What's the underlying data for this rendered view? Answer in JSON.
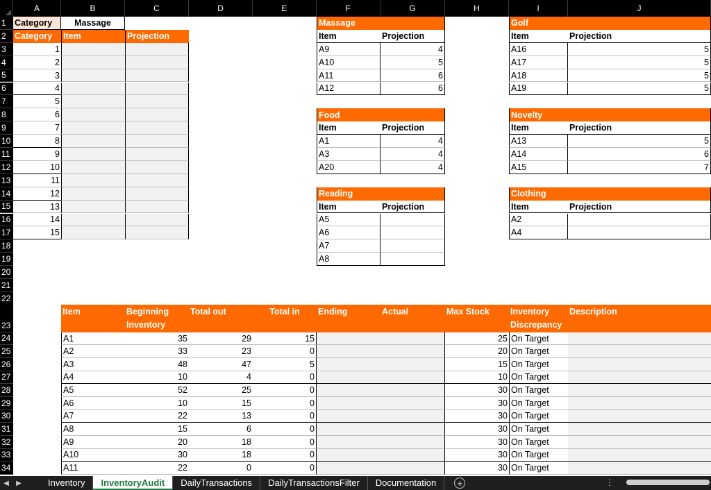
{
  "columns": [
    "A",
    "B",
    "C",
    "D",
    "E",
    "F",
    "G",
    "H",
    "I",
    "J"
  ],
  "rows": [
    "1",
    "2",
    "3",
    "4",
    "5",
    "6",
    "7",
    "8",
    "9",
    "10",
    "11",
    "12",
    "13",
    "14",
    "15",
    "16",
    "17",
    "18",
    "19",
    "20",
    "21",
    "22",
    "23",
    "24",
    "25",
    "26",
    "27",
    "28",
    "29",
    "30",
    "31",
    "32",
    "33",
    "34"
  ],
  "left_panel": {
    "a1": "Category",
    "b1": "Massage",
    "headers": [
      "Category",
      "Item",
      "Projection"
    ],
    "numbers": [
      "1",
      "2",
      "3",
      "4",
      "5",
      "6",
      "7",
      "8",
      "9",
      "10",
      "11",
      "12",
      "13",
      "14",
      "15"
    ]
  },
  "blocks": [
    {
      "title": "Massage",
      "item_label": "Item",
      "proj_label": "Projection",
      "rows": [
        {
          "item": "A9",
          "proj": "4"
        },
        {
          "item": "A10",
          "proj": "5"
        },
        {
          "item": "A11",
          "proj": "6"
        },
        {
          "item": "A12",
          "proj": "6"
        }
      ]
    },
    {
      "title": "Golf",
      "item_label": "Item",
      "proj_label": "Projection",
      "rows": [
        {
          "item": "A16",
          "proj": "5"
        },
        {
          "item": "A17",
          "proj": "5"
        },
        {
          "item": "A18",
          "proj": "5"
        },
        {
          "item": "A19",
          "proj": "5"
        }
      ]
    },
    {
      "title": "Food",
      "item_label": "Item",
      "proj_label": "Projection",
      "rows": [
        {
          "item": "A1",
          "proj": "4"
        },
        {
          "item": "A3",
          "proj": "4"
        },
        {
          "item": "A20",
          "proj": "4"
        }
      ]
    },
    {
      "title": "Novelty",
      "item_label": "Item",
      "proj_label": "Projection",
      "rows": [
        {
          "item": "A13",
          "proj": "5"
        },
        {
          "item": "A14",
          "proj": "6"
        },
        {
          "item": "A15",
          "proj": "7"
        }
      ]
    },
    {
      "title": "Reading",
      "item_label": "Item",
      "proj_label": "Projection",
      "rows": [
        {
          "item": "A5",
          "proj": ""
        },
        {
          "item": "A6",
          "proj": ""
        },
        {
          "item": "A7",
          "proj": ""
        },
        {
          "item": "A8",
          "proj": ""
        }
      ]
    },
    {
      "title": "Clothing",
      "item_label": "Item",
      "proj_label": "Projection",
      "rows": [
        {
          "item": "A2",
          "proj": ""
        },
        {
          "item": "A4",
          "proj": ""
        }
      ]
    }
  ],
  "inventory": {
    "headers": [
      "Item",
      "Beginning Inventory",
      "Total out",
      "Total in",
      "Ending",
      "Actual",
      "Max Stock",
      "Inventory Discrepancy",
      "Description"
    ],
    "rows": [
      {
        "item": "A1",
        "begin": "35",
        "out": "29",
        "in": "15",
        "ending": "",
        "actual": "",
        "max": "25",
        "disc": "On Target",
        "desc": ""
      },
      {
        "item": "A2",
        "begin": "33",
        "out": "23",
        "in": "0",
        "ending": "",
        "actual": "",
        "max": "20",
        "disc": "On Target",
        "desc": ""
      },
      {
        "item": "A3",
        "begin": "48",
        "out": "47",
        "in": "5",
        "ending": "",
        "actual": "",
        "max": "15",
        "disc": "On Target",
        "desc": ""
      },
      {
        "item": "A4",
        "begin": "10",
        "out": "4",
        "in": "0",
        "ending": "",
        "actual": "",
        "max": "10",
        "disc": "On Target",
        "desc": ""
      },
      {
        "item": "A5",
        "begin": "52",
        "out": "25",
        "in": "0",
        "ending": "",
        "actual": "",
        "max": "30",
        "disc": "On Target",
        "desc": ""
      },
      {
        "item": "A6",
        "begin": "10",
        "out": "15",
        "in": "0",
        "ending": "",
        "actual": "",
        "max": "30",
        "disc": "On Target",
        "desc": ""
      },
      {
        "item": "A7",
        "begin": "22",
        "out": "13",
        "in": "0",
        "ending": "",
        "actual": "",
        "max": "30",
        "disc": "On Target",
        "desc": ""
      },
      {
        "item": "A8",
        "begin": "15",
        "out": "6",
        "in": "0",
        "ending": "",
        "actual": "",
        "max": "30",
        "disc": "On Target",
        "desc": ""
      },
      {
        "item": "A9",
        "begin": "20",
        "out": "18",
        "in": "0",
        "ending": "",
        "actual": "",
        "max": "30",
        "disc": "On Target",
        "desc": ""
      },
      {
        "item": "A10",
        "begin": "30",
        "out": "18",
        "in": "0",
        "ending": "",
        "actual": "",
        "max": "30",
        "disc": "On Target",
        "desc": ""
      },
      {
        "item": "A11",
        "begin": "22",
        "out": "0",
        "in": "0",
        "ending": "",
        "actual": "",
        "max": "30",
        "disc": "On Target",
        "desc": ""
      }
    ]
  },
  "tabs": [
    {
      "label": "Inventory",
      "active": false
    },
    {
      "label": "InventoryAudit",
      "active": true
    },
    {
      "label": "DailyTransactions",
      "active": false
    },
    {
      "label": "DailyTransactionsFilter",
      "active": false
    },
    {
      "label": "Documentation",
      "active": false
    }
  ],
  "tab_nav": {
    "prev_icon": "◀",
    "next_icon": "▶",
    "add_icon": "+",
    "options_icon": "⋮"
  },
  "colors": {
    "header_orange": "#ff6a00",
    "shade": "#f1f1f1",
    "active_tab": "#1e7a3c"
  }
}
